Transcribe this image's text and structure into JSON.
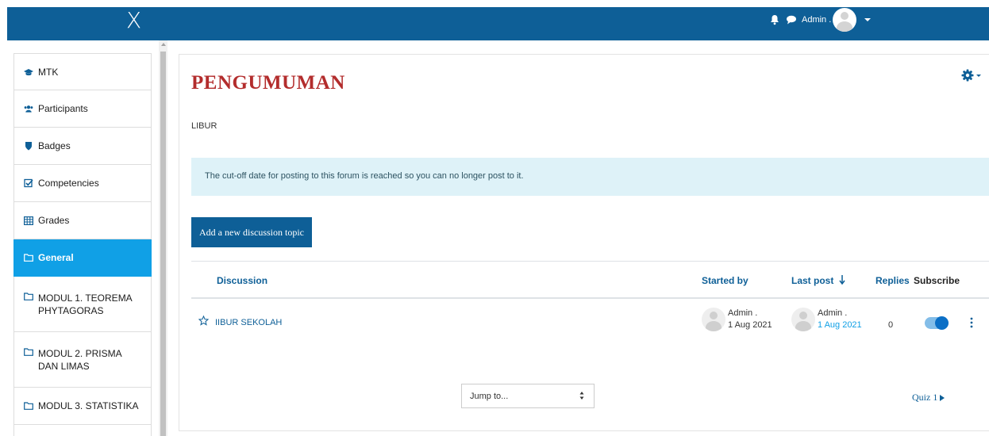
{
  "topbar": {
    "close_glyph": "X",
    "user_name": "Admin .",
    "icons": [
      "bell-icon",
      "chat-icon",
      "user-menu-caret-icon"
    ]
  },
  "sidebar": {
    "items": [
      {
        "label": "MTK",
        "icon": "graduation-cap-icon"
      },
      {
        "label": "Participants",
        "icon": "users-icon"
      },
      {
        "label": "Badges",
        "icon": "shield-icon"
      },
      {
        "label": "Competencies",
        "icon": "checkbox-icon"
      },
      {
        "label": "Grades",
        "icon": "table-icon"
      },
      {
        "label": "General",
        "icon": "folder-icon",
        "active": true
      },
      {
        "label": "MODUL 1. TEOREMA PHYTAGORAS",
        "icon": "folder-icon"
      },
      {
        "label": "MODUL 2. PRISMA DAN LIMAS",
        "icon": "folder-icon"
      },
      {
        "label": "MODUL 3. STATISTIKA",
        "icon": "folder-icon"
      }
    ]
  },
  "main": {
    "title": "PENGUMUMAN",
    "subtitle": "LIBUR",
    "alert": "The cut-off date for posting to this forum is reached so you can no longer post to it.",
    "add_button": "Add a new discussion topic",
    "table": {
      "headers": {
        "discussion": "Discussion",
        "started_by": "Started by",
        "last_post": "Last post",
        "replies": "Replies",
        "subscribe": "Subscribe"
      },
      "rows": [
        {
          "topic": "IIBUR SEKOLAH",
          "started_by_name": "Admin .",
          "started_by_date": "1 Aug 2021",
          "last_post_name": "Admin .",
          "last_post_date": "1 Aug 2021",
          "replies": "0",
          "subscribed": true
        }
      ]
    },
    "jump_to": "Jump to...",
    "next_link": "Quiz 1"
  },
  "colors": {
    "topbar": "#0e5f97",
    "active_nav": "#10a0e6",
    "title": "#b32d2d",
    "alert_bg": "#def2f8"
  }
}
